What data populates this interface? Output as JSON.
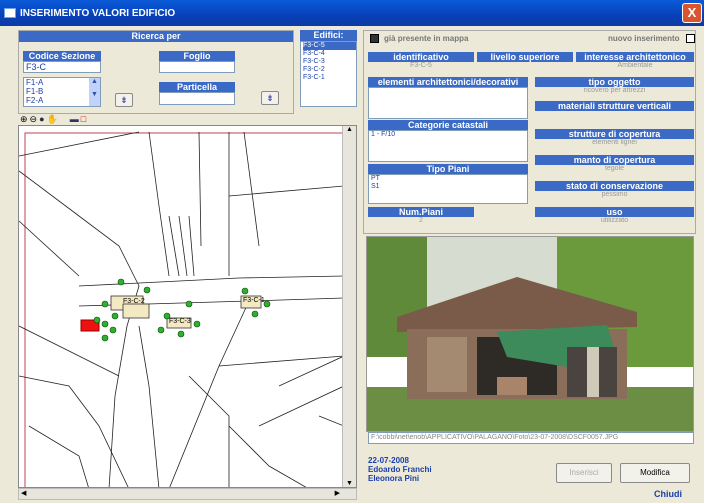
{
  "window": {
    "title": "INSERIMENTO VALORI EDIFICIO",
    "close_label": "X"
  },
  "search": {
    "header": "Ricerca per",
    "codice_sezione_label": "Codice Sezione",
    "codice_sezione_value": "F3-C",
    "sezioni": [
      "F1-A",
      "F1-B",
      "F2-A"
    ],
    "foglio_label": "Foglio",
    "foglio_value": "",
    "particella_label": "Particella",
    "particella_value": ""
  },
  "edifici": {
    "header": "Edifici:",
    "items": [
      "F3-C-5",
      "F3-C-4",
      "F3-C-3",
      "F3-C-2",
      "F3-C-1"
    ]
  },
  "map": {
    "labels": [
      "F3-C-2",
      "F3-C-3",
      "F3-C-1"
    ]
  },
  "right": {
    "gia_presente": "già presente in mappa",
    "nuovo_inserimento": "nuovo inserimento",
    "identificativo_label": "identificativo",
    "identificativo_value": "F3-C-5",
    "livello_superiore_label": "livello superiore",
    "livello_superiore_value": "",
    "interesse_label": "interesse architettonico",
    "interesse_value": "Ambientale",
    "elementi_label": "elementi architettonici/decorativi",
    "tipo_oggetto_label": "tipo oggetto",
    "tipo_oggetto_value": "ricovero per attrezzi",
    "materiali_label": "materiali strutture verticali",
    "materiali_value": "",
    "categorie_label": "Categorie catastali",
    "categorie_value": "1 - F/10",
    "strutture_label": "strutture di copertura",
    "strutture_value": "elementi lignei",
    "manto_label": "manto di copertura",
    "manto_value": "tegole",
    "tipo_piani_label": "Tipo Piani",
    "tipo_piani_values": [
      "PT",
      "S1"
    ],
    "stato_label": "stato di conservazione",
    "stato_value": "pessimo",
    "num_piani_label": "Num.Piani",
    "num_piani_value": "2",
    "uso_label": "uso",
    "uso_value": "utilizzato"
  },
  "photo": {
    "path": "F:\\cobbi\\net\\enob\\APPLICATIVO\\PALAGANO\\Foto\\23-07-2008\\DSCF0057.JPG"
  },
  "footer": {
    "date": "22-07-2008",
    "author1": "Edoardo Franchi",
    "author2": "Eleonora Pini",
    "inserisci_label": "Inserisci",
    "modifica_label": "Modifica",
    "chiudi_label": "Chiudi"
  }
}
